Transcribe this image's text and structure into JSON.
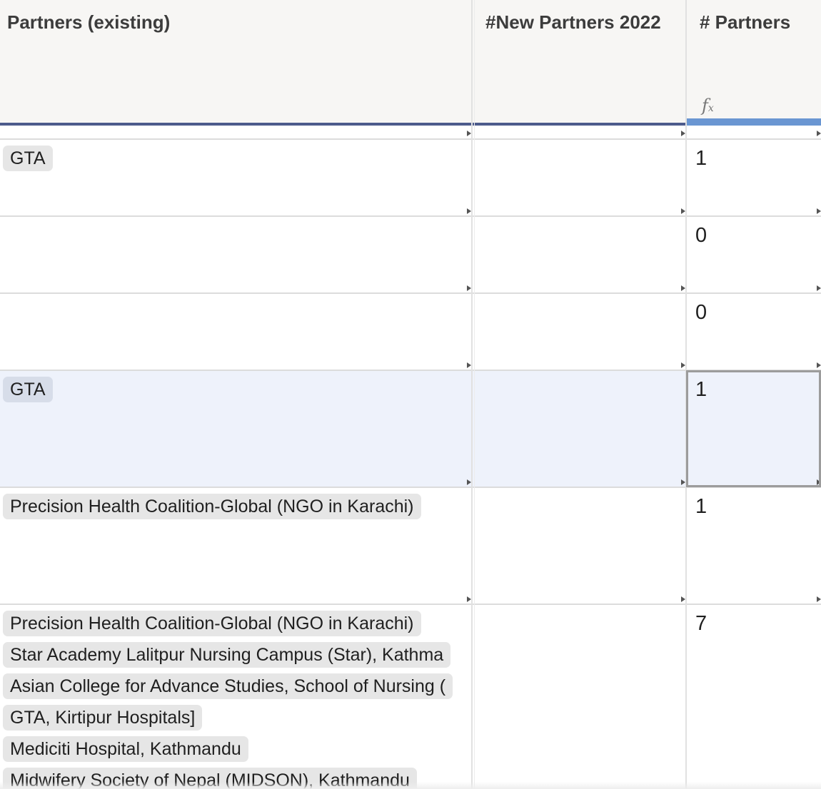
{
  "columns": {
    "partners_existing": "Partners (existing)",
    "new_partners_2022": "#New Partners 2022",
    "num_partners": "# Partners"
  },
  "formula_icon": "fx-icon",
  "accent_colors": {
    "header_underline": "#4d5b8c",
    "selected_column": "#6a96d2",
    "selected_row": "#eef2fb"
  },
  "rows": [
    {
      "partners": [
        "GTA"
      ],
      "new_2022": "",
      "count": "1"
    },
    {
      "partners": [],
      "new_2022": "",
      "count": "0"
    },
    {
      "partners": [],
      "new_2022": "",
      "count": "0"
    },
    {
      "partners": [
        "GTA"
      ],
      "new_2022": "",
      "count": "1",
      "selected": true
    },
    {
      "partners": [
        "Precision Health Coalition-Global (NGO in Karachi)"
      ],
      "new_2022": "",
      "count": "1"
    },
    {
      "partners": [
        "Precision Health Coalition-Global (NGO in Karachi)",
        "Star Academy Lalitpur Nursing Campus (Star), Kathma",
        "Asian College for Advance Studies, School of Nursing (",
        "GTA, Kirtipur Hospitals]",
        "Mediciti Hospital, Kathmandu",
        "Midwifery Society of Nepal (MIDSON), Kathmandu"
      ],
      "new_2022": "",
      "count": "7"
    }
  ]
}
